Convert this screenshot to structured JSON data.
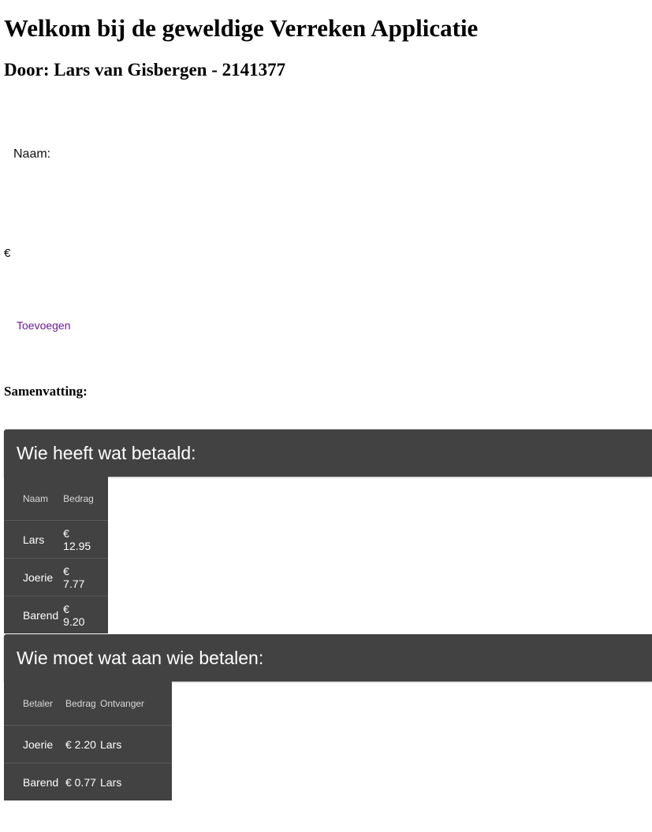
{
  "header": {
    "title": "Welkom bij de geweldige Verreken Applicatie",
    "subtitle": "Door: Lars van Gisbergen - 2141377"
  },
  "form": {
    "name_label": "Naam:",
    "name_value": "",
    "currency_symbol": "€",
    "amount_value": "",
    "add_label": "Toevoegen"
  },
  "summary": {
    "heading": "Samenvatting:",
    "paid_panel": {
      "title": "Wie heeft wat betaald:",
      "headers": [
        "Naam",
        "Bedrag"
      ],
      "rows": [
        {
          "name": "Lars",
          "currency": "€",
          "amount": "12.95"
        },
        {
          "name": "Joerie",
          "currency": "€",
          "amount": "7.77"
        },
        {
          "name": "Barend",
          "currency": "€",
          "amount": "9.20"
        }
      ]
    },
    "owe_panel": {
      "title": "Wie moet wat aan wie betalen:",
      "headers": [
        "Betaler",
        "Bedrag",
        "Ontvanger"
      ],
      "rows": [
        {
          "payer": "Joerie",
          "amount": "€ 2.20",
          "receiver": "Lars"
        },
        {
          "payer": "Barend",
          "amount": "€ 0.77",
          "receiver": "Lars"
        }
      ]
    }
  },
  "colors": {
    "panel_bg": "#424242",
    "link": "#6a1b9a"
  }
}
